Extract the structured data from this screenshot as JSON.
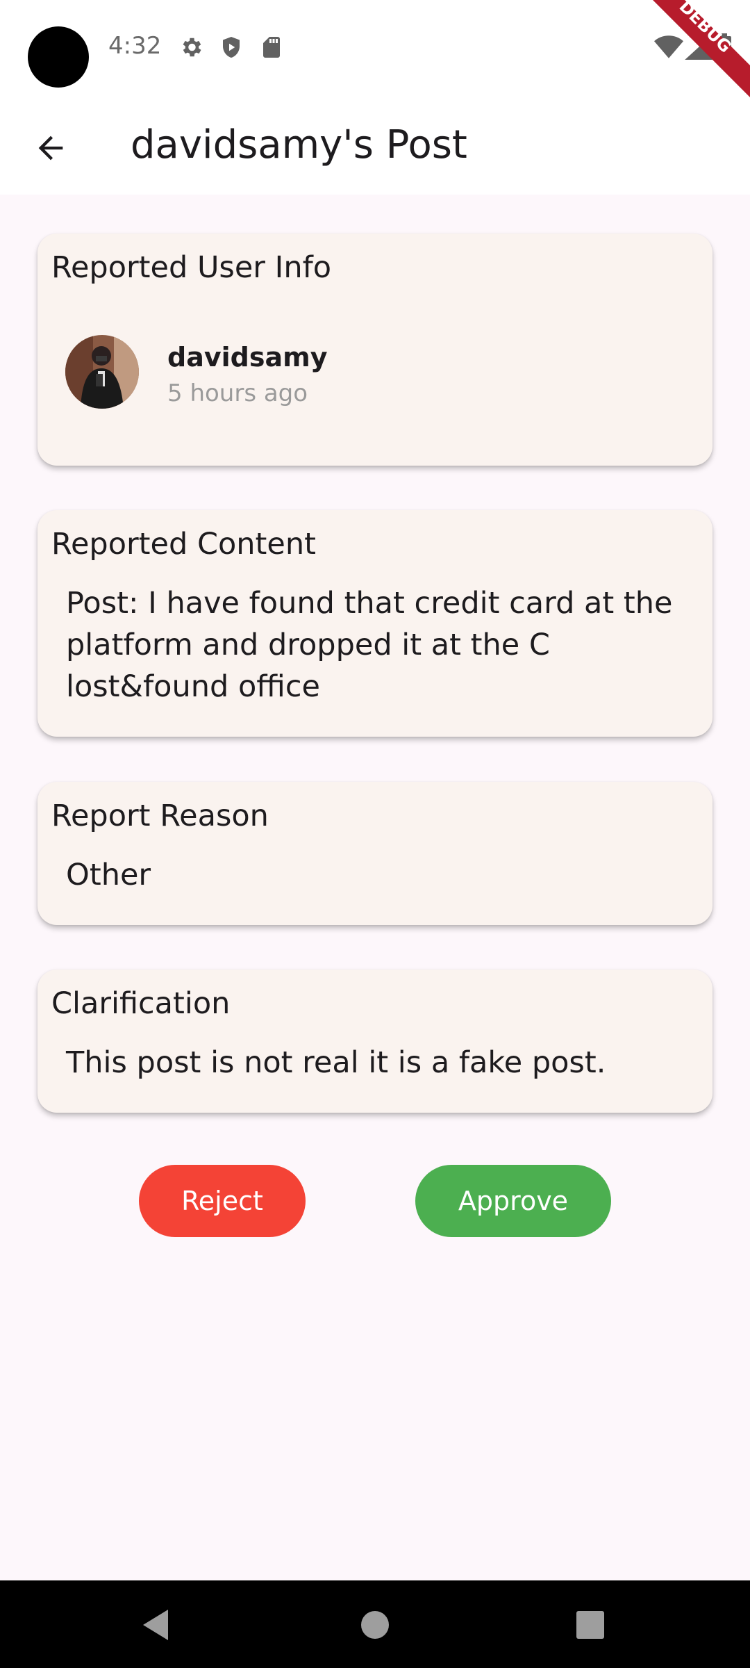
{
  "status_bar": {
    "time": "4:32",
    "icons": [
      "settings-icon",
      "shield-play-icon",
      "sd-card-icon",
      "wifi-icon",
      "signal-icon",
      "battery-icon"
    ]
  },
  "debug_banner": "DEBUG",
  "app_bar": {
    "title": "davidsamy's Post",
    "back_icon": "arrow-back-icon"
  },
  "user_info_card": {
    "title": "Reported User Info",
    "username": "davidsamy",
    "time_ago": "5 hours ago"
  },
  "content_card": {
    "title": "Reported Content",
    "lines": [
      "Post: I have found that credit card at the",
      "platform and dropped it at the C",
      "lost&found office"
    ]
  },
  "reason_card": {
    "title": "Report Reason",
    "value": "Other"
  },
  "clarification_card": {
    "title": "Clarification",
    "value": "This post is not real it is a fake post."
  },
  "actions": {
    "reject_label": "Reject",
    "approve_label": "Approve"
  },
  "colors": {
    "reject": "#f44336",
    "approve": "#4caf50",
    "card_bg": "#faf3ef",
    "page_bg": "#fdf7fb"
  },
  "nav_bar": {
    "icons": [
      "back-triangle-icon",
      "home-circle-icon",
      "recents-square-icon"
    ]
  }
}
